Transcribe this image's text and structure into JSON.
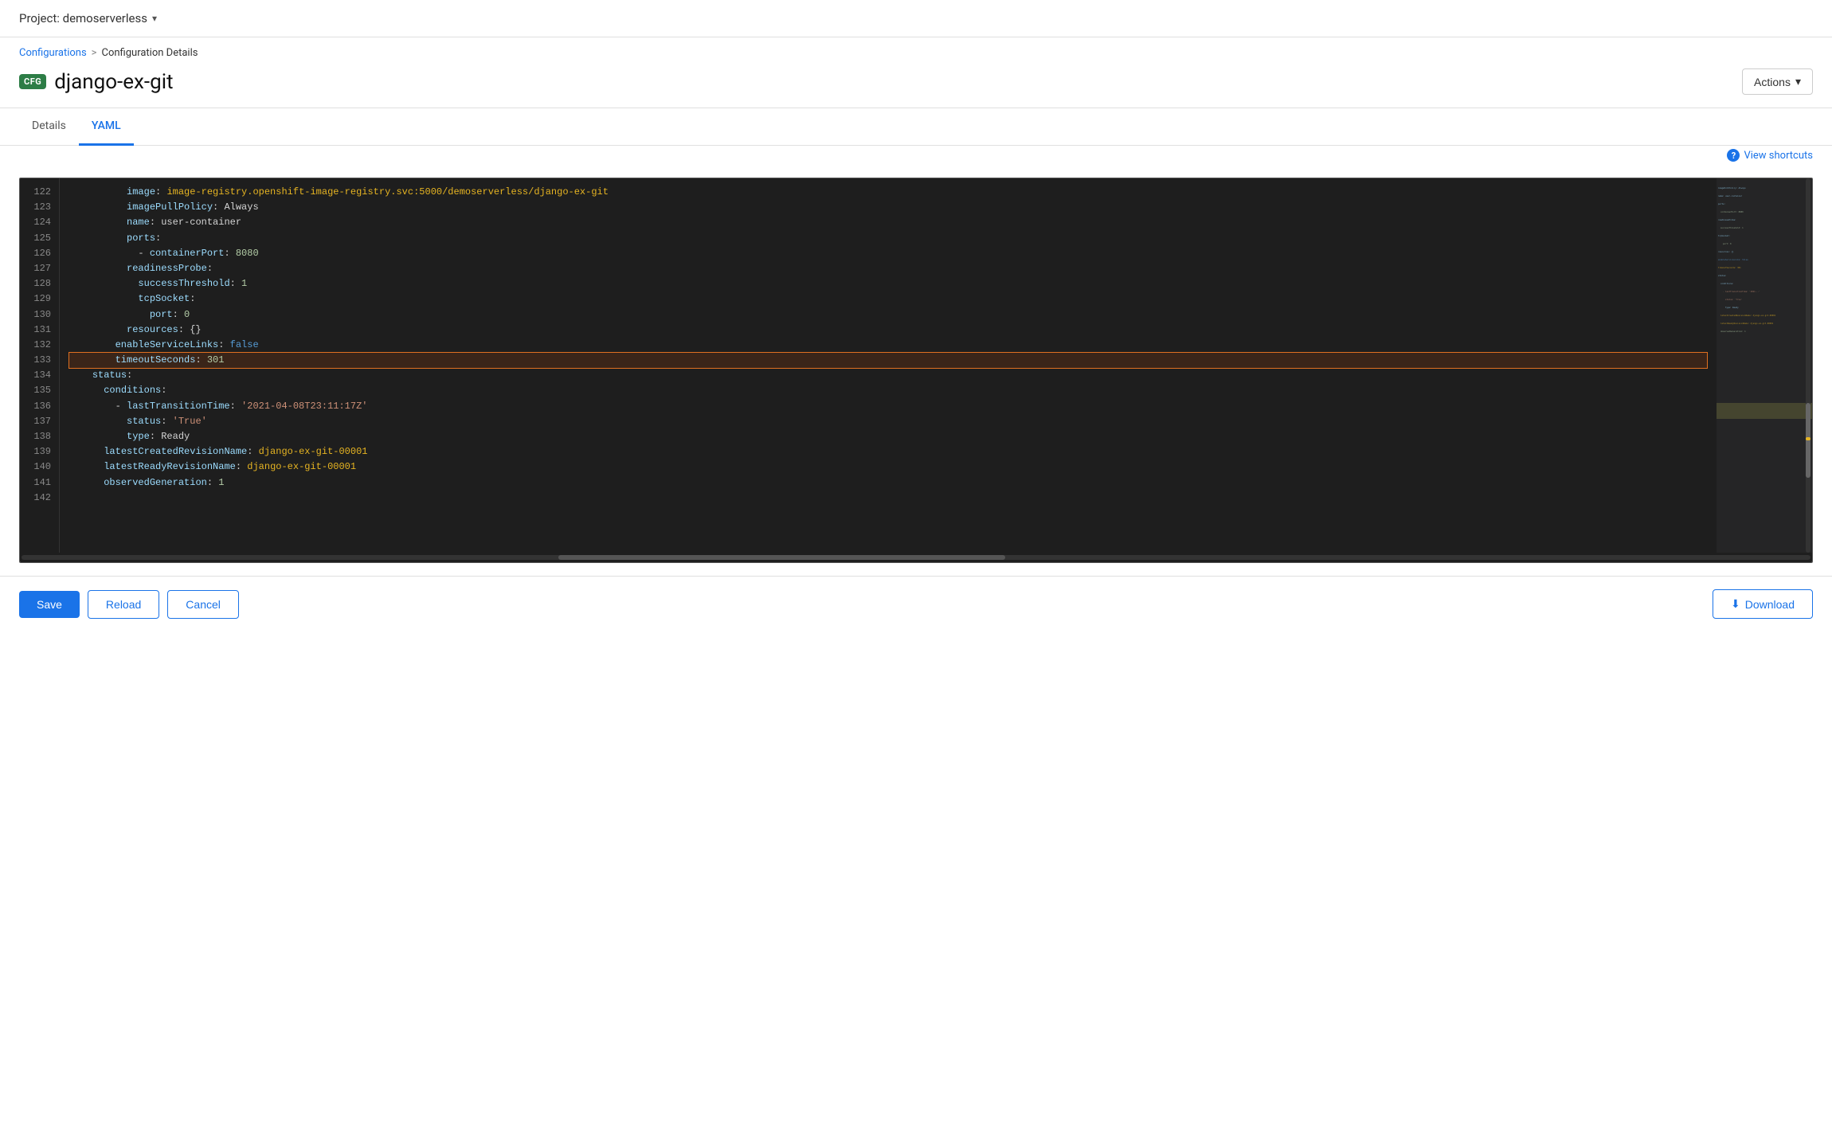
{
  "topBar": {
    "project_label": "Project: demoserverless"
  },
  "breadcrumb": {
    "parent": "Configurations",
    "separator": ">",
    "current": "Configuration Details"
  },
  "header": {
    "badge": "CFG",
    "title": "django-ex-git",
    "actions_label": "Actions"
  },
  "tabs": [
    {
      "id": "details",
      "label": "Details",
      "active": false
    },
    {
      "id": "yaml",
      "label": "YAML",
      "active": true
    }
  ],
  "editor": {
    "shortcuts_label": "View shortcuts",
    "lines": [
      {
        "num": 122,
        "content": "          image: image-registry.openshift-image-registry.svc:5000/demoserverless/django-ex-git",
        "highlight": false
      },
      {
        "num": 123,
        "content": "          imagePullPolicy: Always",
        "highlight": false
      },
      {
        "num": 124,
        "content": "          name: user-container",
        "highlight": false
      },
      {
        "num": 125,
        "content": "          ports:",
        "highlight": false
      },
      {
        "num": 126,
        "content": "            - containerPort: 8080",
        "highlight": false
      },
      {
        "num": 127,
        "content": "          readinessProbe:",
        "highlight": false
      },
      {
        "num": 128,
        "content": "            successThreshold: 1",
        "highlight": false
      },
      {
        "num": 129,
        "content": "            tcpSocket:",
        "highlight": false
      },
      {
        "num": 130,
        "content": "              port: 0",
        "highlight": false
      },
      {
        "num": 131,
        "content": "          resources: {}",
        "highlight": false
      },
      {
        "num": 132,
        "content": "        enableServiceLinks: false",
        "highlight": false
      },
      {
        "num": 133,
        "content": "        timeoutSeconds: 301",
        "highlight": true
      },
      {
        "num": 134,
        "content": "    status:",
        "highlight": false
      },
      {
        "num": 135,
        "content": "      conditions:",
        "highlight": false
      },
      {
        "num": 136,
        "content": "        - lastTransitionTime: '2021-04-08T23:11:17Z'",
        "highlight": false
      },
      {
        "num": 137,
        "content": "          status: 'True'",
        "highlight": false
      },
      {
        "num": 138,
        "content": "          type: Ready",
        "highlight": false
      },
      {
        "num": 139,
        "content": "      latestCreatedRevisionName: django-ex-git-00001",
        "highlight": false
      },
      {
        "num": 140,
        "content": "      latestReadyRevisionName: django-ex-git-00001",
        "highlight": false
      },
      {
        "num": 141,
        "content": "      observedGeneration: 1",
        "highlight": false
      },
      {
        "num": 142,
        "content": "",
        "highlight": false
      }
    ]
  },
  "bottomActions": {
    "save_label": "Save",
    "reload_label": "Reload",
    "cancel_label": "Cancel",
    "download_label": "Download"
  }
}
